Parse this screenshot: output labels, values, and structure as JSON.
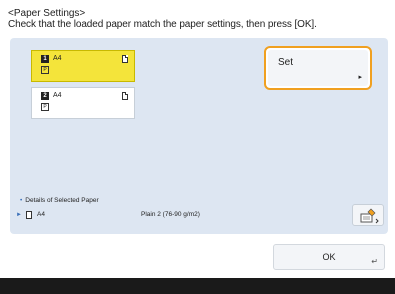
{
  "header": {
    "title": "<Paper Settings>",
    "instruction": "Check that the loaded paper match the paper settings, then press [OK]."
  },
  "drawers": [
    {
      "number": "1",
      "size": "A4",
      "type_glyph": "P",
      "selected": true
    },
    {
      "number": "2",
      "size": "A4",
      "type_glyph": "P",
      "selected": false
    }
  ],
  "set_button": {
    "label": "Set",
    "arrow": "▸"
  },
  "details": {
    "caption": "Details of Selected Paper",
    "size": "A4",
    "paper_type": "Plain 2 (76-90 g/m2)"
  },
  "ok_button": {
    "label": "OK",
    "enter_glyph": "↵"
  },
  "colors": {
    "panel_bg": "#dde6f2",
    "selected_drawer": "#f4e43a",
    "focus_border": "#f0a020",
    "bottom_bar": "#1a1a1a"
  }
}
